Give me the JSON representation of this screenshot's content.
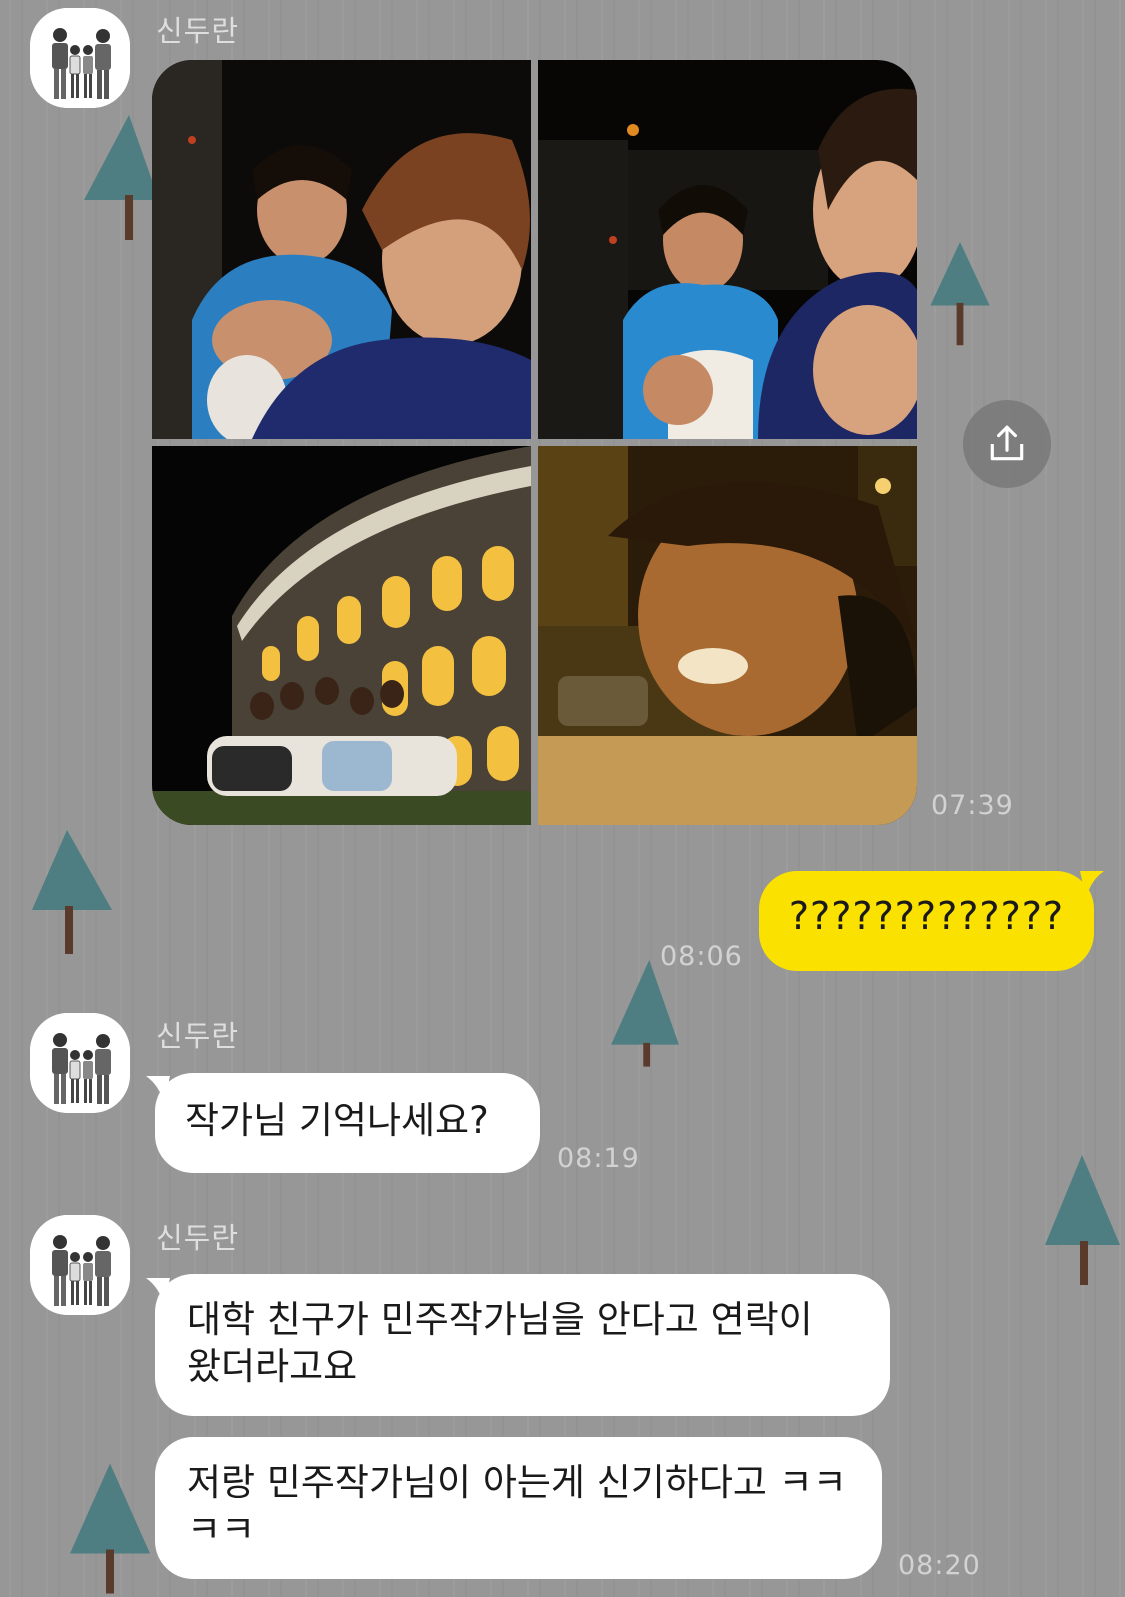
{
  "chat": {
    "messages": [
      {
        "sender": "신두란",
        "type": "photos",
        "time": "07:39",
        "photo_descriptions": []
      },
      {
        "sender": "me",
        "type": "text",
        "text": "?????????????",
        "time": "08:06"
      },
      {
        "sender": "신두란",
        "type": "text",
        "text": "작가님 기억나세요?",
        "time": "08:19"
      },
      {
        "sender": "신두란",
        "type": "text",
        "text": "대학 친구가 민주작가님을 안다고 연락이 왔더라고요",
        "time": ""
      },
      {
        "sender": "신두란",
        "type": "text",
        "text": "저랑 민주작가님이 아는게 신기하다고 ㅋㅋㅋㅋ",
        "time": "08:20"
      }
    ]
  },
  "colors": {
    "background": "#979797",
    "my_bubble": "#fae100",
    "their_bubble": "#ffffff",
    "tree_fill": "#4e7d82",
    "tree_trunk": "#5a3a2a"
  },
  "icons": {
    "share": "share-icon",
    "tree": "tree-icon"
  }
}
